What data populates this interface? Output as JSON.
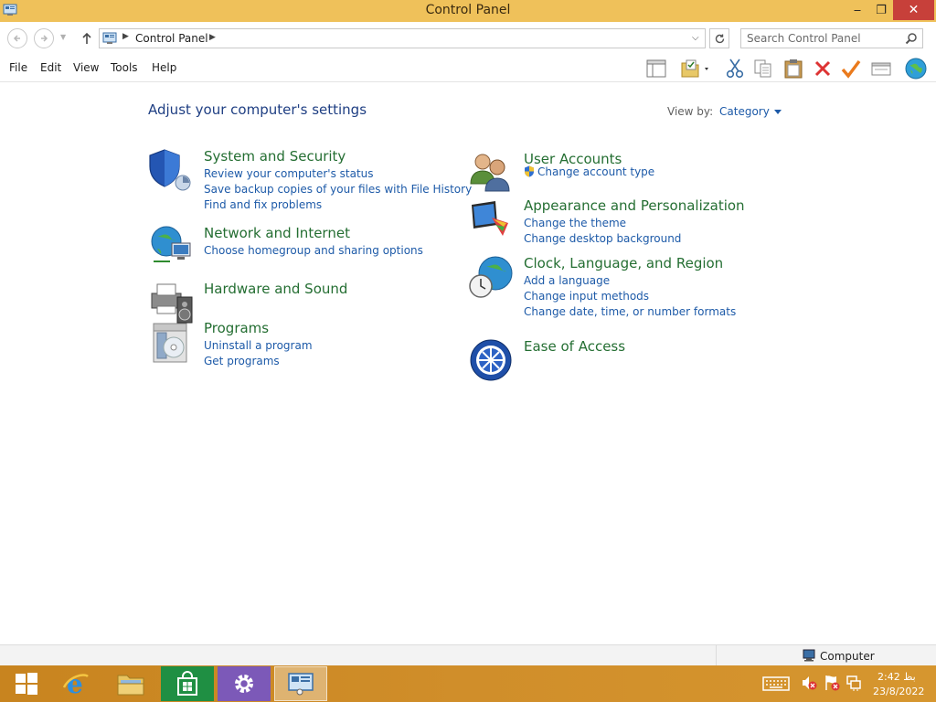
{
  "window": {
    "title": "Control Panel",
    "minimize_glyph": "‒",
    "maximize_glyph": "❐",
    "close_glyph": "✕"
  },
  "address": {
    "crumb": "Control Panel",
    "search_placeholder": "Search Control Panel"
  },
  "menus": [
    "File",
    "Edit",
    "View",
    "Tools",
    "Help"
  ],
  "toolbar_icons": [
    "layout-pane-icon",
    "folder-check-icon",
    "cut-icon",
    "copy-icon",
    "paste-icon",
    "delete-icon",
    "check-icon",
    "properties-icon",
    "globe-icon"
  ],
  "content": {
    "heading": "Adjust your computer's settings",
    "view_by_label": "View by:",
    "view_by_value": "Category",
    "categories": [
      {
        "title": "System and Security",
        "icon": "shield-icon",
        "links": [
          "Review your computer's status",
          "Save backup copies of your files with File History",
          "Find and fix problems"
        ]
      },
      {
        "title": "Network and Internet",
        "icon": "network-globe-icon",
        "links": [
          "Choose homegroup and sharing options"
        ]
      },
      {
        "title": "Hardware and Sound",
        "icon": "printer-speaker-icon",
        "links": []
      },
      {
        "title": "Programs",
        "icon": "programs-disc-icon",
        "links": [
          "Uninstall a program",
          "Get programs"
        ]
      },
      {
        "title": "User Accounts",
        "icon": "users-icon",
        "links": [
          "Change account type"
        ]
      },
      {
        "title": "Appearance and Personalization",
        "icon": "monitor-palette-icon",
        "links": [
          "Change the theme",
          "Change desktop background"
        ]
      },
      {
        "title": "Clock, Language, and Region",
        "icon": "clock-globe-icon",
        "links": [
          "Add a language",
          "Change input methods",
          "Change date, time, or number formats"
        ]
      },
      {
        "title": "Ease of Access",
        "icon": "ease-of-access-icon",
        "links": []
      }
    ]
  },
  "statusbar": {
    "location": "Computer"
  },
  "taskbar": {
    "clock_time": "2:42 بظ",
    "clock_date": "23/8/2022"
  },
  "colors": {
    "titlebar": "#efc15a",
    "category_title": "#246e32",
    "link": "#1d5aa8",
    "heading": "#1f3f83",
    "taskbar": "#d08e2a",
    "close_button": "#c7403a"
  }
}
